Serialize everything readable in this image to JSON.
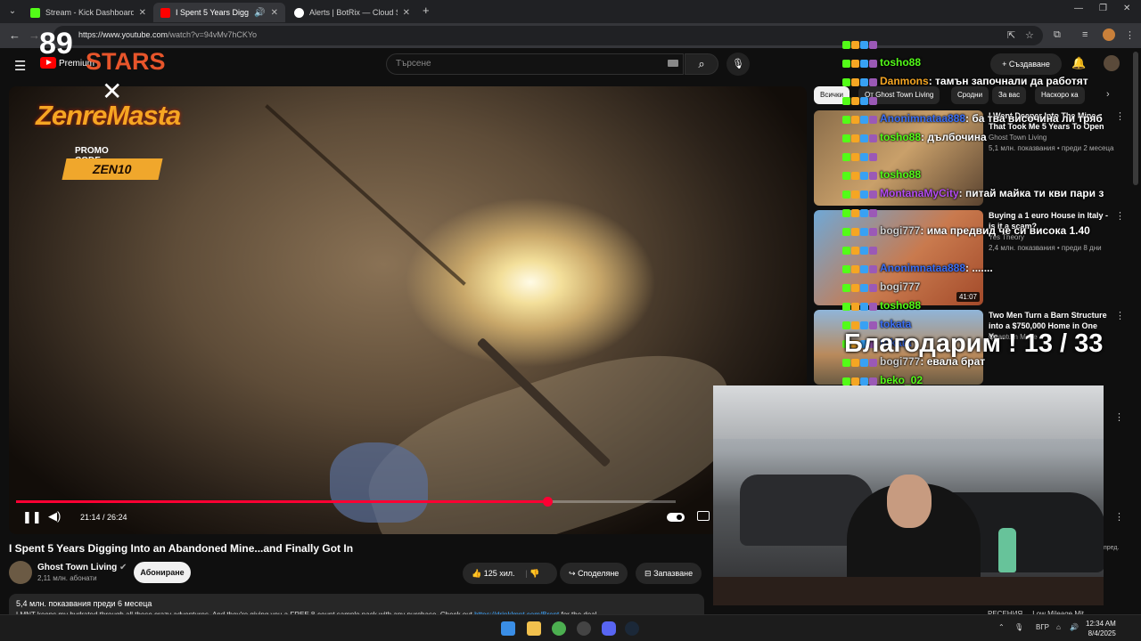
{
  "browser": {
    "tabs": [
      {
        "title": "Stream - Kick Dashboard",
        "color": "#53fc18"
      },
      {
        "title": "I Spent 5 Years Digging Into",
        "color": "#ff0000"
      },
      {
        "title": "Alerts | BotRix — Cloud Stream",
        "color": "#ffffff"
      }
    ],
    "url_host": "https://www.youtube.com",
    "url_path": "/watch?v=94vMv7hCKYo"
  },
  "youtube": {
    "logo_text": "Premium",
    "search_placeholder": "Търсене",
    "create_label": "Създаване"
  },
  "overlay": {
    "num": "89",
    "stars": "STARS",
    "x": "✕",
    "brand": "ZenreMasta",
    "promo": "PROMO CODE",
    "code": "ZEN10"
  },
  "player": {
    "time": "21:14 / 26:24",
    "progress": 0.805
  },
  "video": {
    "title": "I Spent 5 Years Digging Into an Abandoned Mine...and Finally Got In",
    "channel": "Ghost Town Living",
    "subs": "2,11 млн. абонати",
    "subscribe": "Абониране",
    "likes": "125 хил.",
    "share": "Споделяне",
    "save": "Запазване",
    "stats": "5,4 млн. показвания  преди 6 месеца",
    "desc_prefix": "LMNT keeps my hydrated through all these crazy adventures. And they're giving you a FREE 8-count sample pack with any purchase. Check out",
    "desc_link": "https://drinklmnt.com/Brent",
    "desc_suffix": "for the deal"
  },
  "chips": [
    "Всички",
    "От Ghost Town Living",
    "Сродни",
    "За вас",
    "Наскоро ка"
  ],
  "recommended": [
    {
      "title": "I Went Deeper Into The Mine That Took Me 5 Years To Open",
      "channel": "Ghost Town Living",
      "meta": "5,1 млн. показвания • преди 2 месеца",
      "duration": ""
    },
    {
      "title": "Buying a 1 euro House in Italy - is it a scam?",
      "channel": "Yes Theory",
      "meta": "2,4 млн. показвания • преди 8 дни",
      "duration": "41:07"
    },
    {
      "title": "Two Men Turn a Barn Structure into a $750,000 Home in One Ye...",
      "channel": "Quantum Make",
      "meta": "",
      "duration": ""
    }
  ],
  "chat": [
    {
      "user": "",
      "text": "",
      "color": "#53fc18"
    },
    {
      "user": "tosho88",
      "text": "",
      "color": "#53fc18"
    },
    {
      "user": "Danmons",
      "text": ": тамън започнали да работят",
      "color": "#f5a623"
    },
    {
      "user": "",
      "text": "",
      "color": "#53fc18"
    },
    {
      "user": "Anonimnataa888",
      "text": ": ба тва височина ли тряб",
      "color": "#3a6ff5"
    },
    {
      "user": "tosho88",
      "text": ": дълбочина",
      "color": "#53fc18"
    },
    {
      "user": "",
      "text": "",
      "color": "#53fc18"
    },
    {
      "user": "tosho88",
      "text": "",
      "color": "#53fc18"
    },
    {
      "user": "MontanaMyCity",
      "text": ": питай майка ти кви пари з",
      "color": "#b44cf2"
    },
    {
      "user": "",
      "text": "",
      "color": "#53fc18"
    },
    {
      "user": "bogi777",
      "text": ": има предвид че си висока 1.40",
      "color": "#cfcfcf"
    },
    {
      "user": "",
      "text": "",
      "color": "#53fc18"
    },
    {
      "user": "Anonimnataa888",
      "text": ": .......",
      "color": "#3a6ff5"
    },
    {
      "user": "bogi777",
      "text": "",
      "color": "#cfcfcf"
    },
    {
      "user": "tosho88",
      "text": "",
      "color": "#53fc18"
    },
    {
      "user": "tokata",
      "text": "",
      "color": "#3a6ff5"
    },
    {
      "user": "tokata",
      "text": "",
      "color": "#3a6ff5"
    },
    {
      "user": "bogi777",
      "text": ": евала брат",
      "color": "#cfcfcf"
    },
    {
      "user": "beko_02",
      "text": "",
      "color": "#53fc18"
    },
    {
      "user": "",
      "text": "",
      "color": "#53fc18"
    },
    {
      "user": "beko_02",
      "text": "",
      "color": "#53fc18"
    }
  ],
  "thanks": "Благодарим ! 13 / 33",
  "side_snip": "пред.",
  "side_bottom": "РЕСЕНИЯ ... Low Mileage Mit...",
  "taskbar": {
    "lang": "ВГР",
    "time": "12:34 AM",
    "date": "8/4/2025"
  }
}
